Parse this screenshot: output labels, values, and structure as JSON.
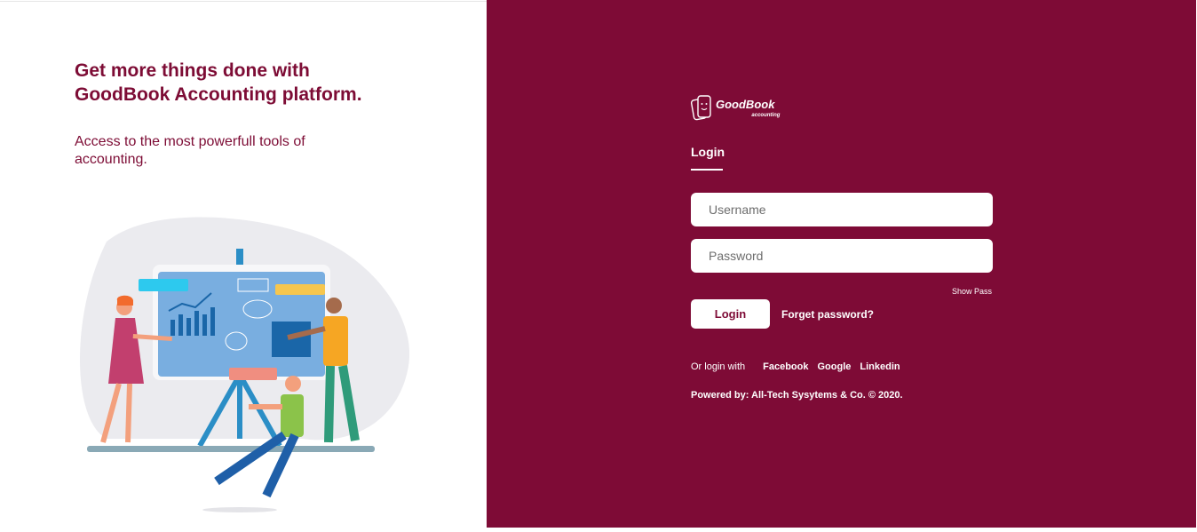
{
  "left": {
    "headline_line1": "Get more things done with",
    "headline_line2": "GoodBook Accounting platform.",
    "subline": "Access to the most powerfull tools of accounting."
  },
  "brand": {
    "logo_text": "GoodBook",
    "logo_sub": "accounting",
    "primary_color": "#7e0b36"
  },
  "login": {
    "tab_label": "Login",
    "username_placeholder": "Username",
    "password_placeholder": "Password",
    "show_pass_label": "Show Pass",
    "login_button": "Login",
    "forget_password": "Forget password?",
    "or_login_with": "Or login with",
    "social": [
      "Facebook",
      "Google",
      "Linkedin"
    ],
    "powered_by": "Powered by: All-Tech Sysytems & Co. © 2020."
  }
}
